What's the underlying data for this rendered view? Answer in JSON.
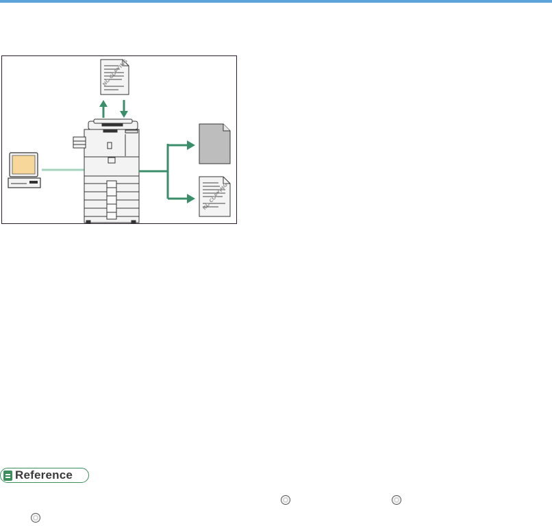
{
  "header": {
    "accent_color": "#5ba3d8"
  },
  "figure": {
    "border_color": "#2b1a2b",
    "arrow_color": "#3a8f6a",
    "line_color": "#a3d3bd",
    "watermark_text": "NO COPYING"
  },
  "reference": {
    "label": "Reference",
    "accent_color": "#3a8f5a",
    "icons": [
      "cd-disc-icon",
      "cd-disc-icon",
      "cd-disc-icon"
    ]
  }
}
